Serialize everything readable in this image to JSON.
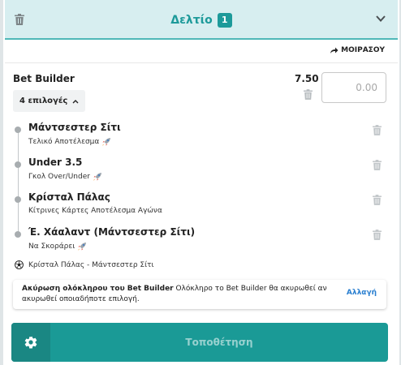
{
  "header": {
    "title": "Δελτίο",
    "badge_count": "1"
  },
  "share": {
    "label": "ΜΟΙΡΑΣΟΥ"
  },
  "bet_builder": {
    "title": "Bet Builder",
    "odds": "7.50",
    "stake_placeholder": "0.00",
    "selections_toggle": "4 επιλογές"
  },
  "legs": [
    {
      "name": "Μάντσεστερ Σίτι",
      "market": "Τελικό Αποτέλεσμα",
      "icon": "rocket-icon"
    },
    {
      "name": "Under 3.5",
      "market": "Γκολ Over/Under",
      "icon": "rocket-icon"
    },
    {
      "name": "Κρίσταλ Πάλας",
      "market": "Κίτρινες Κάρτες Αποτέλεσμα Αγώνα",
      "icon": ""
    },
    {
      "name": "Έ. Χάαλαντ (Μάντσεστερ Σίτι)",
      "market": "Να Σκοράρει",
      "icon": "rocket-icon"
    }
  ],
  "match": {
    "label": "Κρίσταλ Πάλας - Μάντσεστερ Σίτι"
  },
  "info": {
    "bold_text": "Ακύρωση ολόκληρου του Bet Builder",
    "text": " Ολόκληρο το Bet Builder θα ακυρωθεί αν ακυρωθεί οποιαδήποτε επιλογή.",
    "action_label": "Αλλαγή"
  },
  "place_bet": {
    "label": "Τοποθέτηση"
  },
  "colors": {
    "accent": "#1d9a9a",
    "header_bg": "#d7eef0",
    "link": "#2a7fd0"
  }
}
